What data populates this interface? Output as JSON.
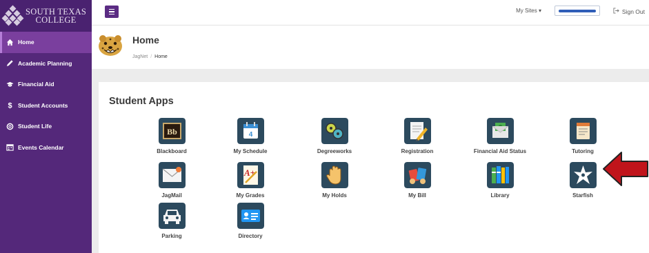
{
  "sidebar": {
    "logo_line1": "SOUTH TEXAS",
    "logo_line2": "COLLEGE",
    "items": [
      {
        "label": "Home",
        "icon": "home-icon"
      },
      {
        "label": "Academic Planning",
        "icon": "pencil-icon"
      },
      {
        "label": "Financial Aid",
        "icon": "graduation-cap-icon"
      },
      {
        "label": "Student Accounts",
        "icon": "dollar-icon"
      },
      {
        "label": "Student Life",
        "icon": "life-ring-icon"
      },
      {
        "label": "Events Calendar",
        "icon": "calendar-icon"
      }
    ]
  },
  "topbar": {
    "my_sites": "My Sites ▾",
    "sign_out": "Sign Out"
  },
  "header": {
    "title": "Home",
    "breadcrumb": [
      "JagNet",
      "Home"
    ]
  },
  "apps": {
    "title": "Student Apps",
    "items": [
      {
        "label": "Blackboard",
        "icon": "blackboard-icon"
      },
      {
        "label": "My Schedule",
        "icon": "calendar-icon"
      },
      {
        "label": "Degreeworks",
        "icon": "degreeworks-icon"
      },
      {
        "label": "Registration",
        "icon": "registration-icon"
      },
      {
        "label": "Financial Aid Status",
        "icon": "money-envelope-icon"
      },
      {
        "label": "Tutoring",
        "icon": "tutoring-icon"
      },
      {
        "label": "JagMail",
        "icon": "mail-icon"
      },
      {
        "label": "My Grades",
        "icon": "grades-icon"
      },
      {
        "label": "My Holds",
        "icon": "hand-icon"
      },
      {
        "label": "My Bill",
        "icon": "bill-icon"
      },
      {
        "label": "Library",
        "icon": "books-icon"
      },
      {
        "label": "Starfish",
        "icon": "starfish-icon"
      },
      {
        "label": "Parking",
        "icon": "car-icon"
      },
      {
        "label": "Directory",
        "icon": "id-card-icon"
      }
    ]
  },
  "colors": {
    "sidebar": "#54287a",
    "sidebar_active": "#7a3f9e",
    "tile": "#2c4a5e",
    "arrow": "#c0141b"
  }
}
